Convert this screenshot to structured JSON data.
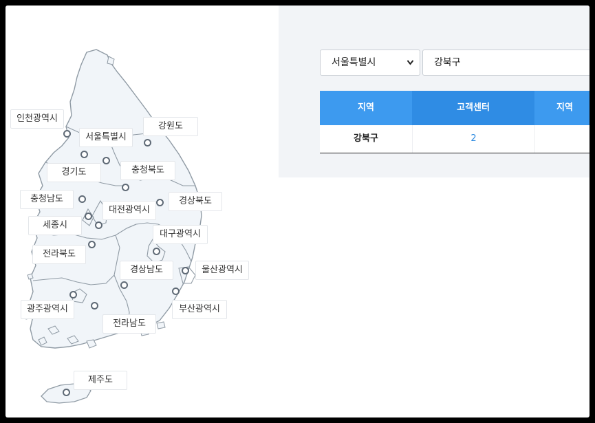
{
  "colors": {
    "header_blue": "#3d9aef",
    "header_blue_active": "#2f8ce4",
    "link_blue": "#2d8ae0",
    "map_fill": "#f1f5f9",
    "map_stroke": "#8f9aa4",
    "panel_bg": "#f2f4f7"
  },
  "map": {
    "regions": [
      {
        "id": "incheon",
        "label": "인천광역시"
      },
      {
        "id": "seoul",
        "label": "서울특별시"
      },
      {
        "id": "gangwon",
        "label": "강원도"
      },
      {
        "id": "gyeonggi",
        "label": "경기도"
      },
      {
        "id": "chungbuk",
        "label": "충청북도"
      },
      {
        "id": "chungnam",
        "label": "충청남도"
      },
      {
        "id": "gyeongbuk",
        "label": "경상북도"
      },
      {
        "id": "daejeon",
        "label": "대전광역시"
      },
      {
        "id": "sejong",
        "label": "세종시"
      },
      {
        "id": "daegu",
        "label": "대구광역시"
      },
      {
        "id": "jeonbuk",
        "label": "전라북도"
      },
      {
        "id": "gyeongnam",
        "label": "경상남도"
      },
      {
        "id": "ulsan",
        "label": "울산광역시"
      },
      {
        "id": "gwangju",
        "label": "광주광역시"
      },
      {
        "id": "busan",
        "label": "부산광역시"
      },
      {
        "id": "jeonnam",
        "label": "전라남도"
      },
      {
        "id": "jeju",
        "label": "제주도"
      }
    ]
  },
  "filters": {
    "city_select": {
      "value": "서울특별시",
      "icon": "chevron-down-icon"
    },
    "district_input": {
      "value": "강북구"
    }
  },
  "table": {
    "headers": [
      "지역",
      "고객센터",
      "지역"
    ],
    "rows": [
      {
        "region": "강북구",
        "centers": "2",
        "region2": ""
      }
    ]
  }
}
